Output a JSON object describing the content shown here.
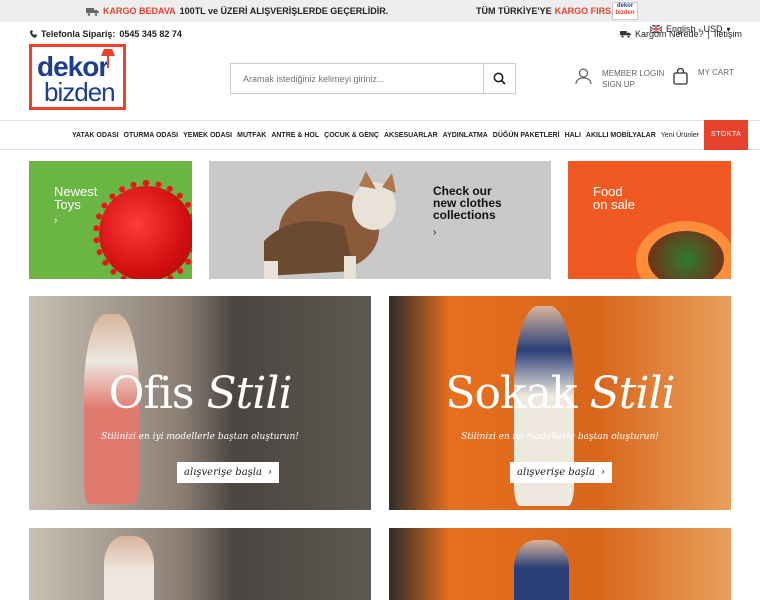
{
  "topbar": {
    "free_shipping_label": "KARGO BEDAVA",
    "free_shipping_text": "100TL ve ÜZERİ ALIŞVERİŞLERDE GEÇERLİDİR.",
    "turkey_text": "TÜM TÜRKİYE'YE",
    "turkey_label": "KARGO FIRSATI",
    "mini_logo_top": "dekor",
    "mini_logo_bottom": "bizden"
  },
  "header": {
    "phone_label": "Telefonla Sipariş:",
    "phone_number": "0545 345 82 74",
    "language": "English - USD",
    "track": "Kargom Nerede?",
    "contact": "İletişim"
  },
  "logo": {
    "top": "dekor",
    "bottom": "bizden"
  },
  "search": {
    "placeholder": "Aramak istediğiniz kelimeyi giriniz..."
  },
  "account": {
    "member_login": "MEMBER LOGIN",
    "sign_up": "SIGN UP",
    "cart": "MY CART"
  },
  "nav": {
    "items": [
      "YATAK ODASI",
      "OTURMA ODASI",
      "YEMEK ODASI",
      "MUTFAK",
      "ANTRE & HOL",
      "ÇOCUK & GENÇ",
      "AKSESUARLAR",
      "AYDINLATMA",
      "DÜĞÜN PAKETLERİ",
      "HALI",
      "AKILLI MOBİLYALAR",
      "Yeni Ürünler"
    ],
    "stock_label": "STOKTA"
  },
  "promo": {
    "toys_line1": "Newest",
    "toys_line2": "Toys",
    "clothes_line1": "Check our",
    "clothes_line2": "new clothes",
    "clothes_line3": "collections",
    "food_line1": "Food",
    "food_line2": "on sale",
    "arrow": "›"
  },
  "hero": {
    "left_word": "Ofis",
    "left_italic": "Stili",
    "right_word": "Sokak",
    "right_italic": "Stili",
    "subtitle": "Stilinizi en iyi modellerle baştan oluşturun!",
    "button": "alışverişe başla",
    "button_arrow": "›"
  },
  "colors": {
    "accent": "#e8412c",
    "brand": "#1d3f8f",
    "green": "#6bb545",
    "orange": "#f05a22"
  }
}
